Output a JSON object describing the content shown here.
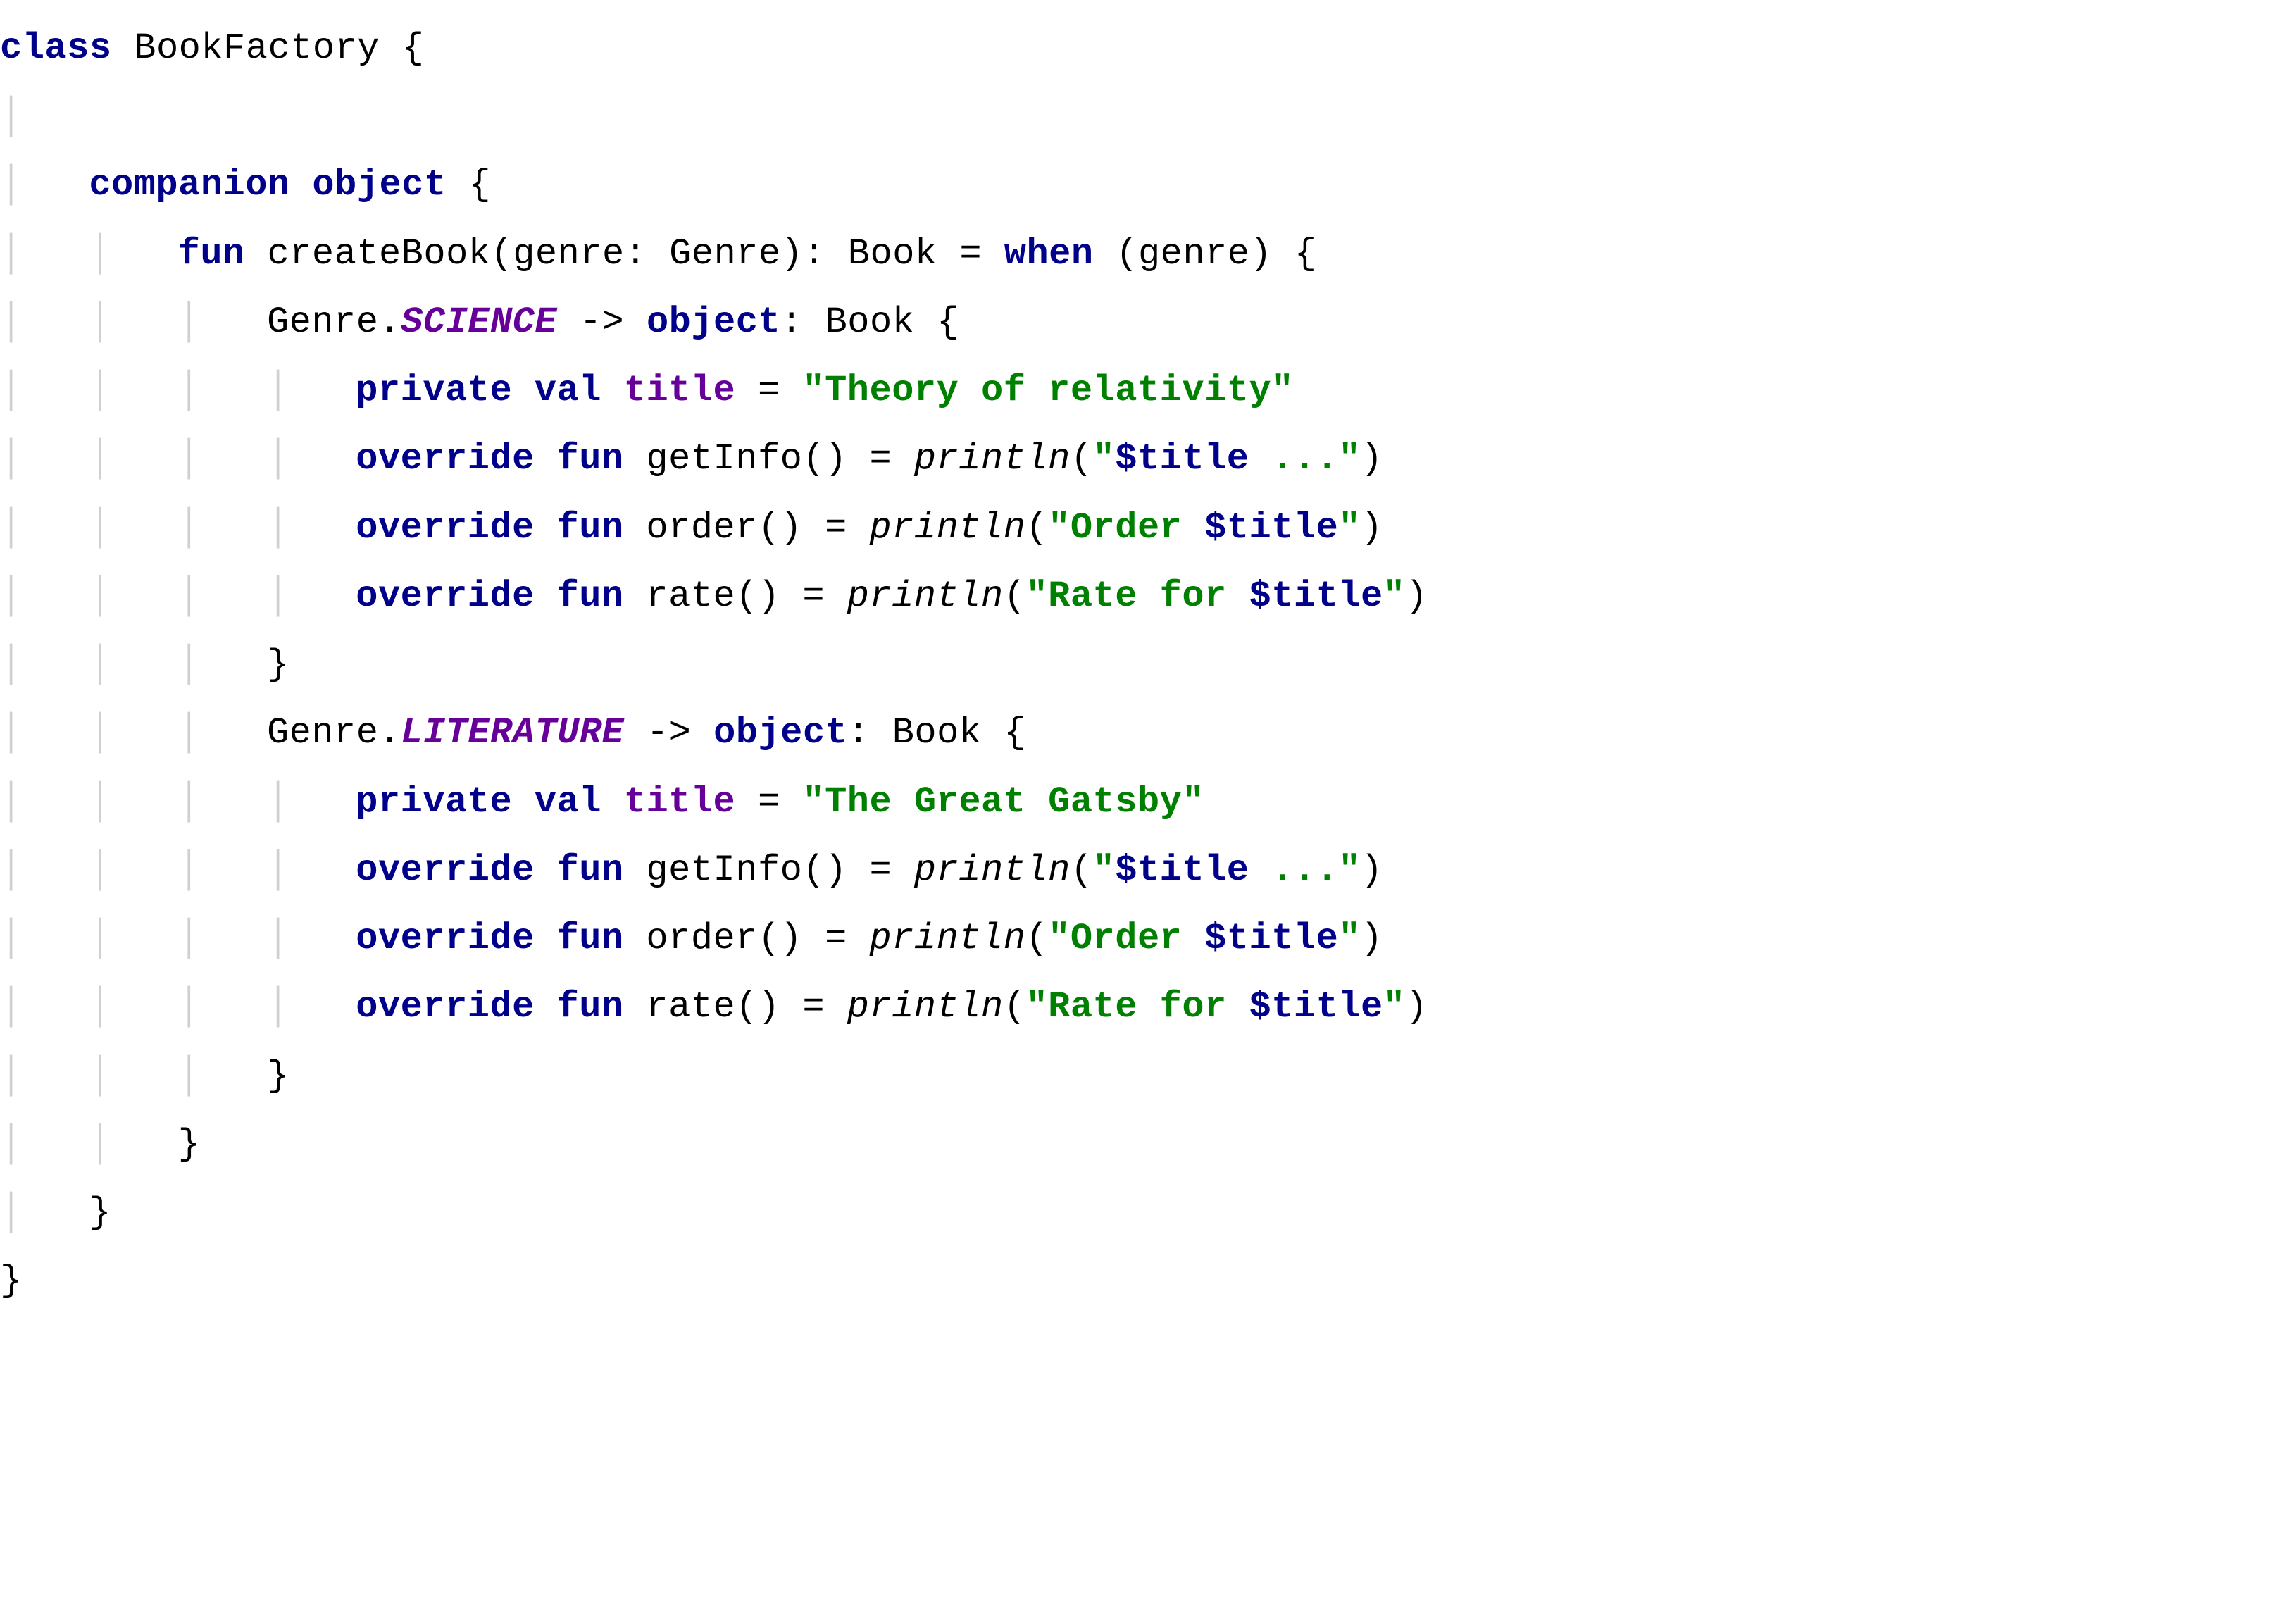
{
  "code": {
    "kw_class": "class",
    "class_name": " BookFactory ",
    "brace_open": "{",
    "kw_companion": "companion object",
    "kw_fun": "fun",
    "fun_name": " createBook",
    "sig_rest": "(genre: Genre): Book = ",
    "kw_when": "when",
    "when_rest": " (genre) ",
    "enum_type": "Genre.",
    "enum_science": "SCIENCE",
    "enum_literature": "LITERATURE",
    "arrow": " -> ",
    "kw_object": "object",
    "obj_rest": ": Book ",
    "kw_private_val": "private val",
    "prop_title": "title",
    "eq": " = ",
    "str_science": "\"Theory of relativity\"",
    "str_gatsby": "\"The Great Gatsby\"",
    "kw_override_fun": "override fun",
    "m_getInfo": " getInfo() = ",
    "m_order": " order() = ",
    "m_rate": " rate() = ",
    "fn_println": "println",
    "pa_open": "(",
    "pa_close": ")",
    "q": "\"",
    "tvar": "$title",
    "tail_info": " ...\"",
    "lead_order": "\"Order ",
    "lead_rate": "\"Rate for ",
    "brace_close": "}",
    "sp": " "
  }
}
